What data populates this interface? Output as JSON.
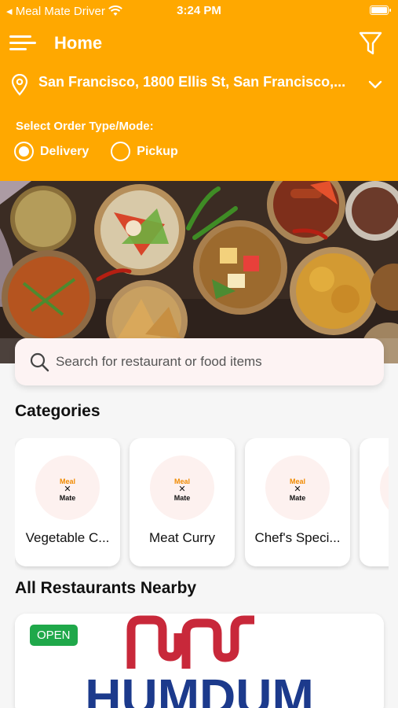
{
  "status_bar": {
    "carrier": "◂ Meal Mate Driver",
    "time": "3:24 PM"
  },
  "app_bar": {
    "title": "Home"
  },
  "location": {
    "address": "San Francisco, 1800 Ellis St, San Francisco,..."
  },
  "order_type": {
    "label": "Select Order Type/Mode:",
    "options": [
      {
        "label": "Delivery",
        "selected": true
      },
      {
        "label": "Pickup",
        "selected": false
      }
    ]
  },
  "search": {
    "placeholder": "Search for restaurant or food items"
  },
  "categories": {
    "title": "Categories",
    "items": [
      {
        "label": "Vegetable C..."
      },
      {
        "label": "Meat Curry"
      },
      {
        "label": "Chef's Speci..."
      }
    ],
    "logo": {
      "line1": "Meal",
      "line2": "✕",
      "line3": "Mate"
    }
  },
  "restaurants": {
    "title": "All Restaurants Nearby",
    "items": [
      {
        "status": "OPEN",
        "logo_text": "HUMDUM"
      }
    ]
  },
  "colors": {
    "header": "#ffa800",
    "open_badge": "#1fa84a",
    "logo_red": "#c8283a",
    "logo_blue": "#1c3a8c"
  }
}
